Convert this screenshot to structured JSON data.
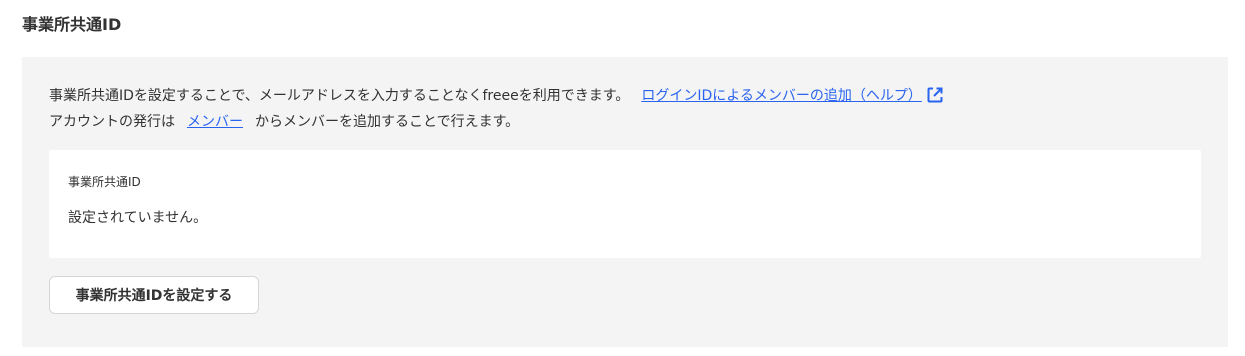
{
  "section": {
    "title": "事業所共通ID"
  },
  "description": {
    "line1_text": "事業所共通IDを設定することで、メールアドレスを入力することなくfreeeを利用できます。",
    "help_link": "ログインIDによるメンバーの追加（ヘルプ）",
    "help_icon": "external-link-icon",
    "line2_prefix": "アカウントの発行は",
    "member_link": "メンバー",
    "line2_suffix": "からメンバーを追加することで行えます。"
  },
  "info": {
    "label": "事業所共通ID",
    "value": "設定されていません。"
  },
  "actions": {
    "set_button_label": "事業所共通IDを設定する"
  },
  "colors": {
    "link": "#2864f0",
    "panel_bg": "#f5f4f4",
    "text": "#323232"
  }
}
